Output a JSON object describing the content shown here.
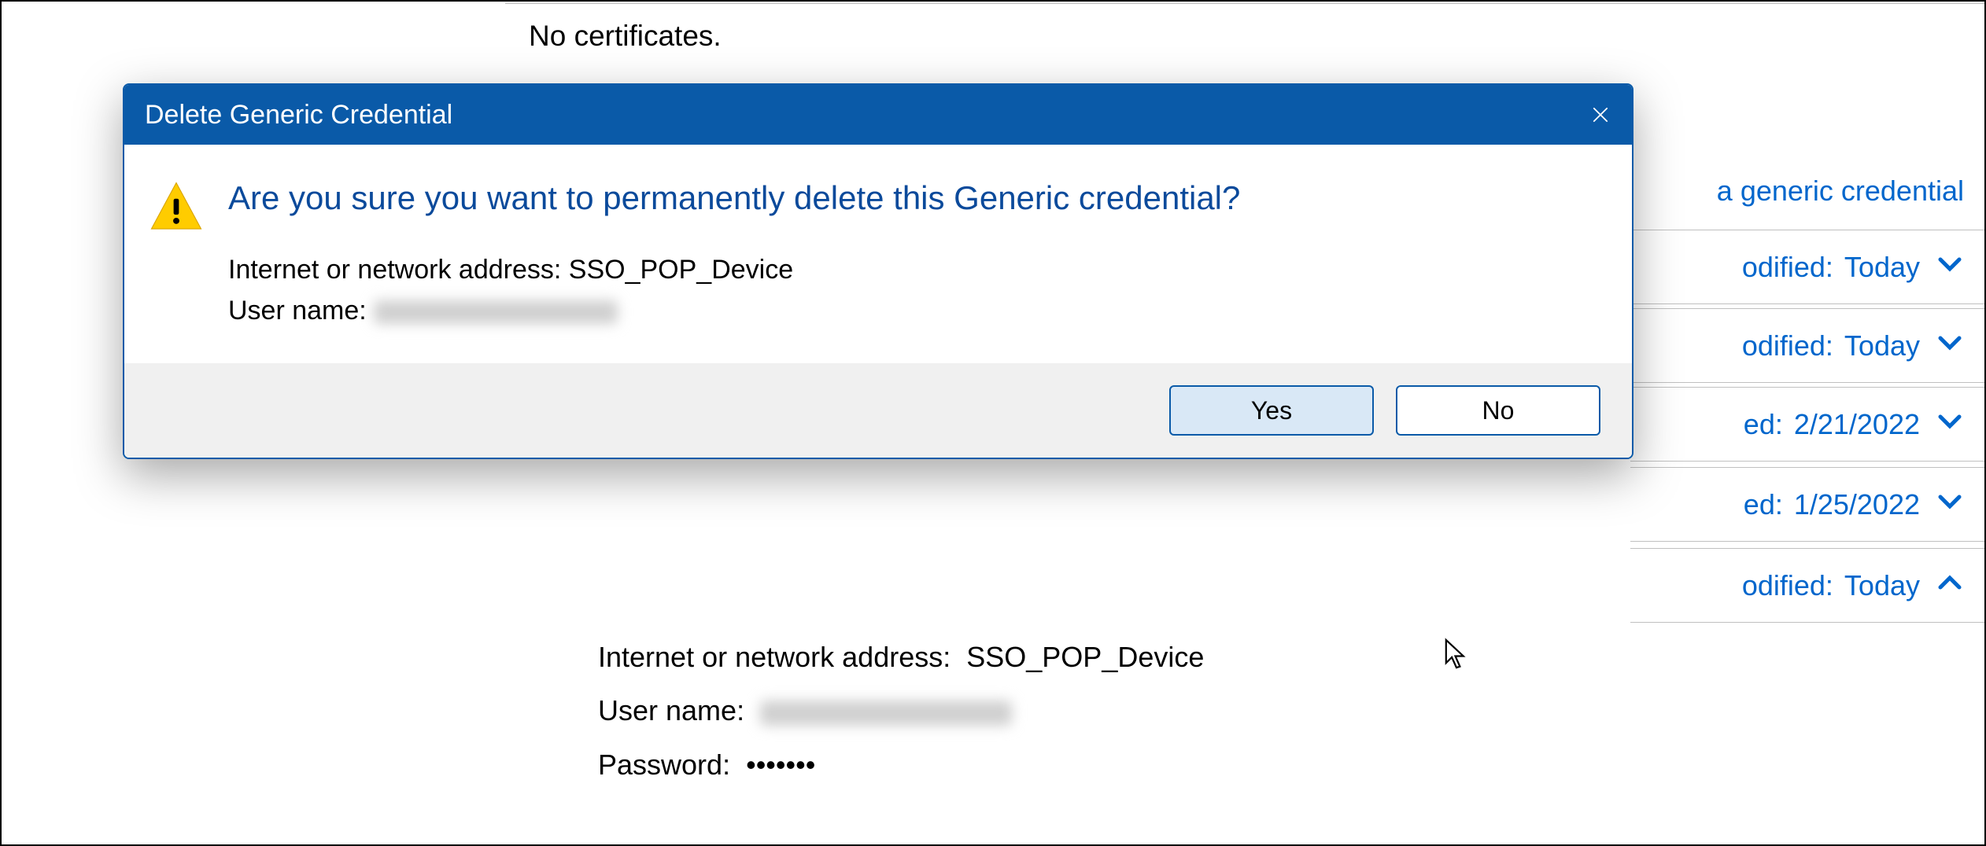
{
  "background": {
    "no_certificates_text": "No certificates.",
    "add_generic_credential": "a generic credential",
    "rows": [
      {
        "label": "odified:",
        "value": "Today",
        "chevron": "down"
      },
      {
        "label": "odified:",
        "value": "Today",
        "chevron": "down"
      },
      {
        "label": "ed:",
        "value": "2/21/2022",
        "chevron": "down"
      },
      {
        "label": "ed:",
        "value": "1/25/2022",
        "chevron": "down"
      },
      {
        "label": "odified:",
        "value": "Today",
        "chevron": "up"
      }
    ],
    "details": {
      "address_label": "Internet or network address:",
      "address_value": "SSO_POP_Device",
      "username_label": "User name:",
      "password_label": "Password:",
      "password_value": "•••••••"
    }
  },
  "dialog": {
    "title": "Delete Generic Credential",
    "heading": "Are you sure you want to permanently delete this Generic credential?",
    "address_label": "Internet or network address:",
    "address_value": "SSO_POP_Device",
    "username_label": "User name:",
    "yes_label": "Yes",
    "no_label": "No"
  }
}
